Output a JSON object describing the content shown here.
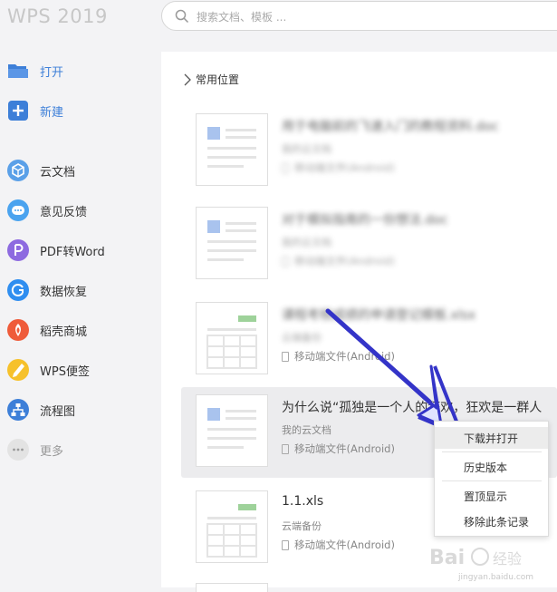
{
  "app": {
    "title": "WPS 2019"
  },
  "search": {
    "placeholder": "搜索文档、模板 ..."
  },
  "sidebar": {
    "items": [
      {
        "label": "打开",
        "icon": "folder-open-icon"
      },
      {
        "label": "新建",
        "icon": "plus-icon"
      },
      {
        "label": "云文档",
        "icon": "cloud-cube-icon"
      },
      {
        "label": "意见反馈",
        "icon": "chat-bubble-icon"
      },
      {
        "label": "PDF转Word",
        "icon": "pdf-to-word-icon"
      },
      {
        "label": "数据恢复",
        "icon": "data-recovery-icon"
      },
      {
        "label": "稻壳商城",
        "icon": "docer-store-icon"
      },
      {
        "label": "WPS便签",
        "icon": "pen-note-icon"
      },
      {
        "label": "流程图",
        "icon": "flowchart-icon"
      },
      {
        "label": "更多",
        "icon": "more-dots-icon"
      }
    ]
  },
  "main": {
    "breadcrumb": "常用位置",
    "files": [
      {
        "name": "用于电脑前的飞速入门的教程资料.doc",
        "location": "我的云文档",
        "source": "移动端文件(Android)",
        "type": "doc",
        "blurred": true
      },
      {
        "name": "对于模拟指南的一份想法.doc",
        "location": "我的云文档",
        "source": "移动端文件(Android)",
        "type": "doc",
        "blurred": true
      },
      {
        "name": "课程考核成绩的申请登记模板.xlsx",
        "location": "云端备份",
        "source": "移动端文件(Android)",
        "type": "xls",
        "blurred": true
      },
      {
        "name": "为什么说“孤独是一个人的狂欢，狂欢是一群人",
        "location": "我的云文档",
        "source": "移动端文件(Android)",
        "type": "doc",
        "blurred": false
      },
      {
        "name": "1.1.xls",
        "location": "云端备份",
        "source": "移动端文件(Android)",
        "type": "xls",
        "blurred": false
      }
    ]
  },
  "context_menu": {
    "items": [
      {
        "label": "下载并打开"
      },
      {
        "label": "历史版本"
      },
      {
        "label": "置顶显示"
      },
      {
        "label": "移除此条记录"
      }
    ]
  },
  "watermark": {
    "text": "jingyan.baidu.com"
  },
  "colors": {
    "accent": "#3d7fd8",
    "arrow": "#3434c8",
    "selected_row": "#ececee"
  }
}
